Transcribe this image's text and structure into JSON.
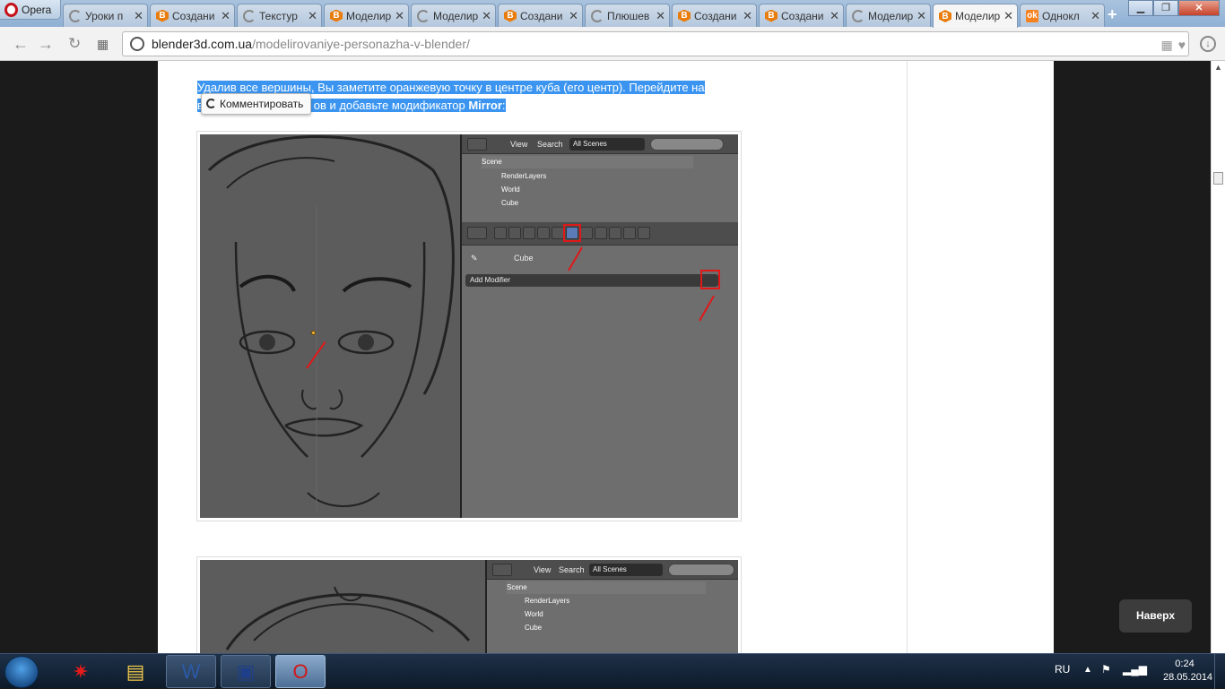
{
  "browser": {
    "menu_label": "Opera",
    "tabs": [
      {
        "label": "Уроки п",
        "icon": "loading-icon"
      },
      {
        "label": "Создани",
        "icon": "blender-icon"
      },
      {
        "label": "Текстур",
        "icon": "loading-icon"
      },
      {
        "label": "Моделир",
        "icon": "blender-icon"
      },
      {
        "label": "Моделир",
        "icon": "loading-icon"
      },
      {
        "label": "Создани",
        "icon": "blender-icon"
      },
      {
        "label": "Плюшев",
        "icon": "loading-icon"
      },
      {
        "label": "Создани",
        "icon": "blender-icon"
      },
      {
        "label": "Создани",
        "icon": "blender-icon"
      },
      {
        "label": "Моделир",
        "icon": "loading-icon"
      },
      {
        "label": "Моделир",
        "icon": "blender-icon",
        "active": true
      },
      {
        "label": "Однокл",
        "icon": "odnoklassniki-icon"
      }
    ],
    "new_tab": "+",
    "url_host": "blender3d.com.ua",
    "url_path": "/modelirovaniye-personazha-v-blender/"
  },
  "article": {
    "para_part1": "Удалив все вершины, Вы заметите оранжевую точку в центре куба (его центр). Перейдите на",
    "para_part2_prefix": "в",
    "para_part2_hidden": "ов и добавьте модификатор ",
    "para_bold": "Mirror",
    "para_end": ":",
    "tooltip": "Комментировать"
  },
  "screenshot1": {
    "header_view": "View",
    "header_search": "Search",
    "scenes_dropdown": "All Scenes",
    "tree": [
      "Scene",
      "RenderLayers",
      "World",
      "Cube"
    ],
    "breadcrumb_object": "Cube",
    "add_modifier": "Add Modifier"
  },
  "screenshot2": {
    "header_view": "View",
    "header_search": "Search",
    "scenes_dropdown": "All Scenes",
    "tree": [
      "Scene",
      "RenderLayers",
      "World",
      "Cube"
    ]
  },
  "back_to_top": "Наверх",
  "taskbar": {
    "language": "RU",
    "time": "0:24",
    "date": "28.05.2014"
  }
}
